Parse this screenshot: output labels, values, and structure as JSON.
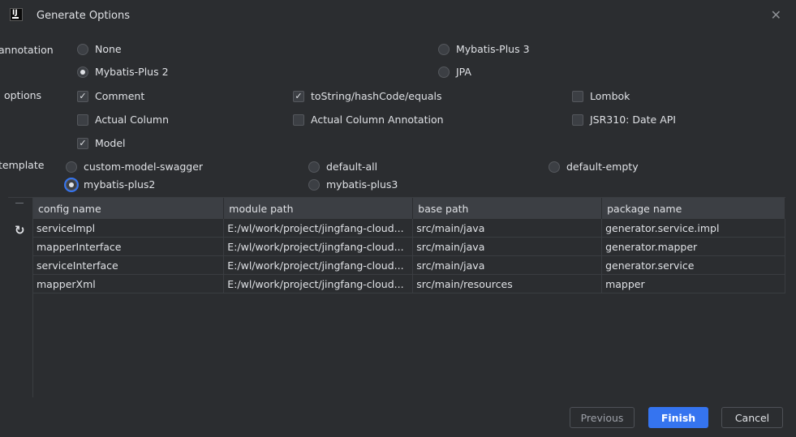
{
  "window": {
    "title": "Generate Options",
    "app_icon_text": "IJ"
  },
  "labels": {
    "annotation": "annotation",
    "options": "options",
    "template": "template"
  },
  "annotation": {
    "none": "None",
    "mybatis_plus_2": "Mybatis-Plus 2",
    "mybatis_plus_3": "Mybatis-Plus 3",
    "jpa": "JPA",
    "selected": "Mybatis-Plus 2"
  },
  "options": {
    "comment": {
      "label": "Comment",
      "checked": true
    },
    "tostring": {
      "label": "toString/hashCode/equals",
      "checked": true
    },
    "lombok": {
      "label": "Lombok",
      "checked": false
    },
    "actual_column": {
      "label": "Actual Column",
      "checked": false
    },
    "actual_column_annotation": {
      "label": "Actual Column Annotation",
      "checked": false
    },
    "jsr310": {
      "label": "JSR310: Date API",
      "checked": false
    },
    "model": {
      "label": "Model",
      "checked": true
    }
  },
  "template": {
    "custom_model_swagger": "custom-model-swagger",
    "default_all": "default-all",
    "default_empty": "default-empty",
    "mybatis_plus2": "mybatis-plus2",
    "mybatis_plus3": "mybatis-plus3",
    "selected": "mybatis-plus2"
  },
  "table": {
    "columns": [
      "config name",
      "module path",
      "base path",
      "package name"
    ],
    "rows": [
      [
        "serviceImpl",
        "E:/wl/work/project/jingfang-cloud...",
        "src/main/java",
        "generator.service.impl"
      ],
      [
        "mapperInterface",
        "E:/wl/work/project/jingfang-cloud...",
        "src/main/java",
        "generator.mapper"
      ],
      [
        "serviceInterface",
        "E:/wl/work/project/jingfang-cloud...",
        "src/main/java",
        "generator.service"
      ],
      [
        "mapperXml",
        "E:/wl/work/project/jingfang-cloud...",
        "src/main/resources",
        "mapper"
      ]
    ]
  },
  "buttons": {
    "previous": "Previous",
    "finish": "Finish",
    "cancel": "Cancel"
  },
  "colors": {
    "background": "#2b2d30",
    "accent": "#3574f0",
    "text": "#dfe1e5"
  }
}
